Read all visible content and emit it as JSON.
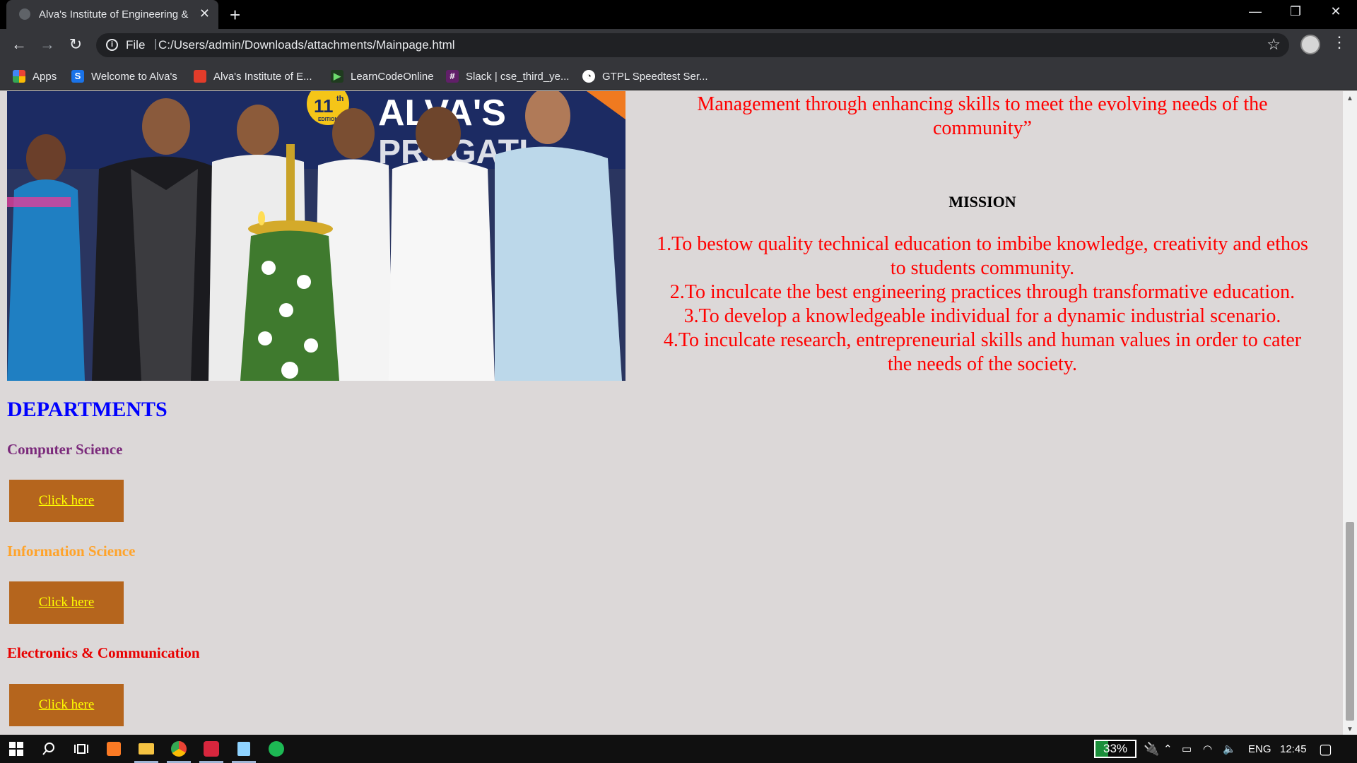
{
  "browser": {
    "tab_title": "Alva's Institute of Engineering &",
    "tab_close": "✕",
    "new_tab": "+",
    "window": {
      "minimize": "—",
      "restore": "❐",
      "close": "✕"
    },
    "nav": {
      "back": "←",
      "forward": "→",
      "reload": "↻"
    },
    "address": {
      "scheme": "File",
      "separator": "|",
      "url": "C:/Users/admin/Downloads/attachments/Mainpage.html"
    },
    "menu": "⋮",
    "star": "☆",
    "bookmarks": [
      {
        "label": "Apps",
        "icon": "apps-grid-icon",
        "color": "#e8453c"
      },
      {
        "label": "Welcome to Alva's",
        "icon": "s-icon",
        "color": "#1a73e8"
      },
      {
        "label": "Alva's Institute of E...",
        "icon": "alvas-icon",
        "color": "#e23c2a"
      },
      {
        "label": "LearnCodeOnline",
        "icon": "play-icon",
        "color": "#2e7d32"
      },
      {
        "label": "Slack | cse_third_ye...",
        "icon": "slack-icon",
        "color": "#611f69"
      },
      {
        "label": "GTPL Speedtest Ser...",
        "icon": "speedtest-icon",
        "color": "#ffffff"
      }
    ]
  },
  "page": {
    "vision_lines": [
      "Management through enhancing skills to meet the evolving needs of the",
      "community”"
    ],
    "mission_heading": "MISSION",
    "mission_lines": [
      "1.To bestow quality technical education to imbibe knowledge, creativity and ethos",
      "to students community.",
      "2.To inculcate the best engineering practices through transformative education.",
      "3.To develop a knowledgeable individual for a dynamic industrial scenario.",
      "4.To inculcate research, entrepreneurial skills and human values in order to cater",
      "the needs of the society."
    ],
    "photo": {
      "badge_top": "11",
      "badge_sup": "th",
      "badge_sub": "EDITION",
      "banner_text": "ALVA'S",
      "banner_text2": "PRAGATI"
    },
    "departments_heading": "DEPARTMENTS",
    "departments": [
      {
        "name": "Computer Science",
        "color": "#7b2a7b",
        "button": "Click here"
      },
      {
        "name": "Information Science",
        "color": "#ffa32a",
        "button": "Click here"
      },
      {
        "name": "Electronics & Communication",
        "color": "#e80000",
        "button": "Click here"
      }
    ]
  },
  "taskbar": {
    "battery": "33%",
    "lang": "ENG",
    "time": "12:45"
  }
}
